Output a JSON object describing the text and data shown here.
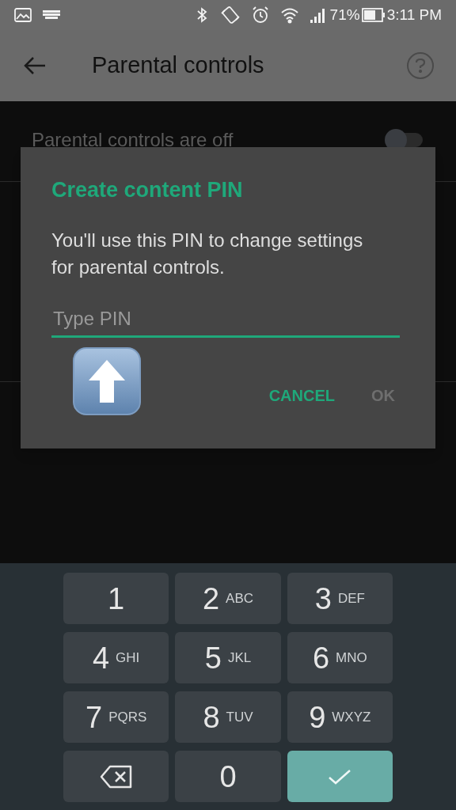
{
  "status_bar": {
    "battery": "71%",
    "time": "3:11 PM"
  },
  "app_bar": {
    "title": "Parental controls"
  },
  "settings": [
    {
      "label": "Parental controls are off",
      "on": false
    }
  ],
  "dialog": {
    "title": "Create content PIN",
    "message": "You'll use this PIN to change settings for parental controls.",
    "pin_field": {
      "placeholder": "Type PIN"
    },
    "buttons": [
      {
        "label": "CANCEL",
        "disabled": false
      },
      {
        "label": "OK",
        "disabled": true
      }
    ]
  },
  "keypad": [
    {
      "kind": "digit",
      "digit": "1"
    },
    {
      "kind": "digit",
      "digit": "2",
      "letters": "ABC"
    },
    {
      "kind": "digit",
      "digit": "3",
      "letters": "DEF"
    },
    {
      "kind": "digit",
      "digit": "4",
      "letters": "GHI"
    },
    {
      "kind": "digit",
      "digit": "5",
      "letters": "JKL"
    },
    {
      "kind": "digit",
      "digit": "6",
      "letters": "MNO"
    },
    {
      "kind": "digit",
      "digit": "7",
      "letters": "PQRS"
    },
    {
      "kind": "digit",
      "digit": "8",
      "letters": "TUV"
    },
    {
      "kind": "digit",
      "digit": "9",
      "letters": "WXYZ"
    },
    {
      "kind": "backspace"
    },
    {
      "kind": "digit",
      "digit": "0"
    },
    {
      "kind": "done"
    }
  ]
}
